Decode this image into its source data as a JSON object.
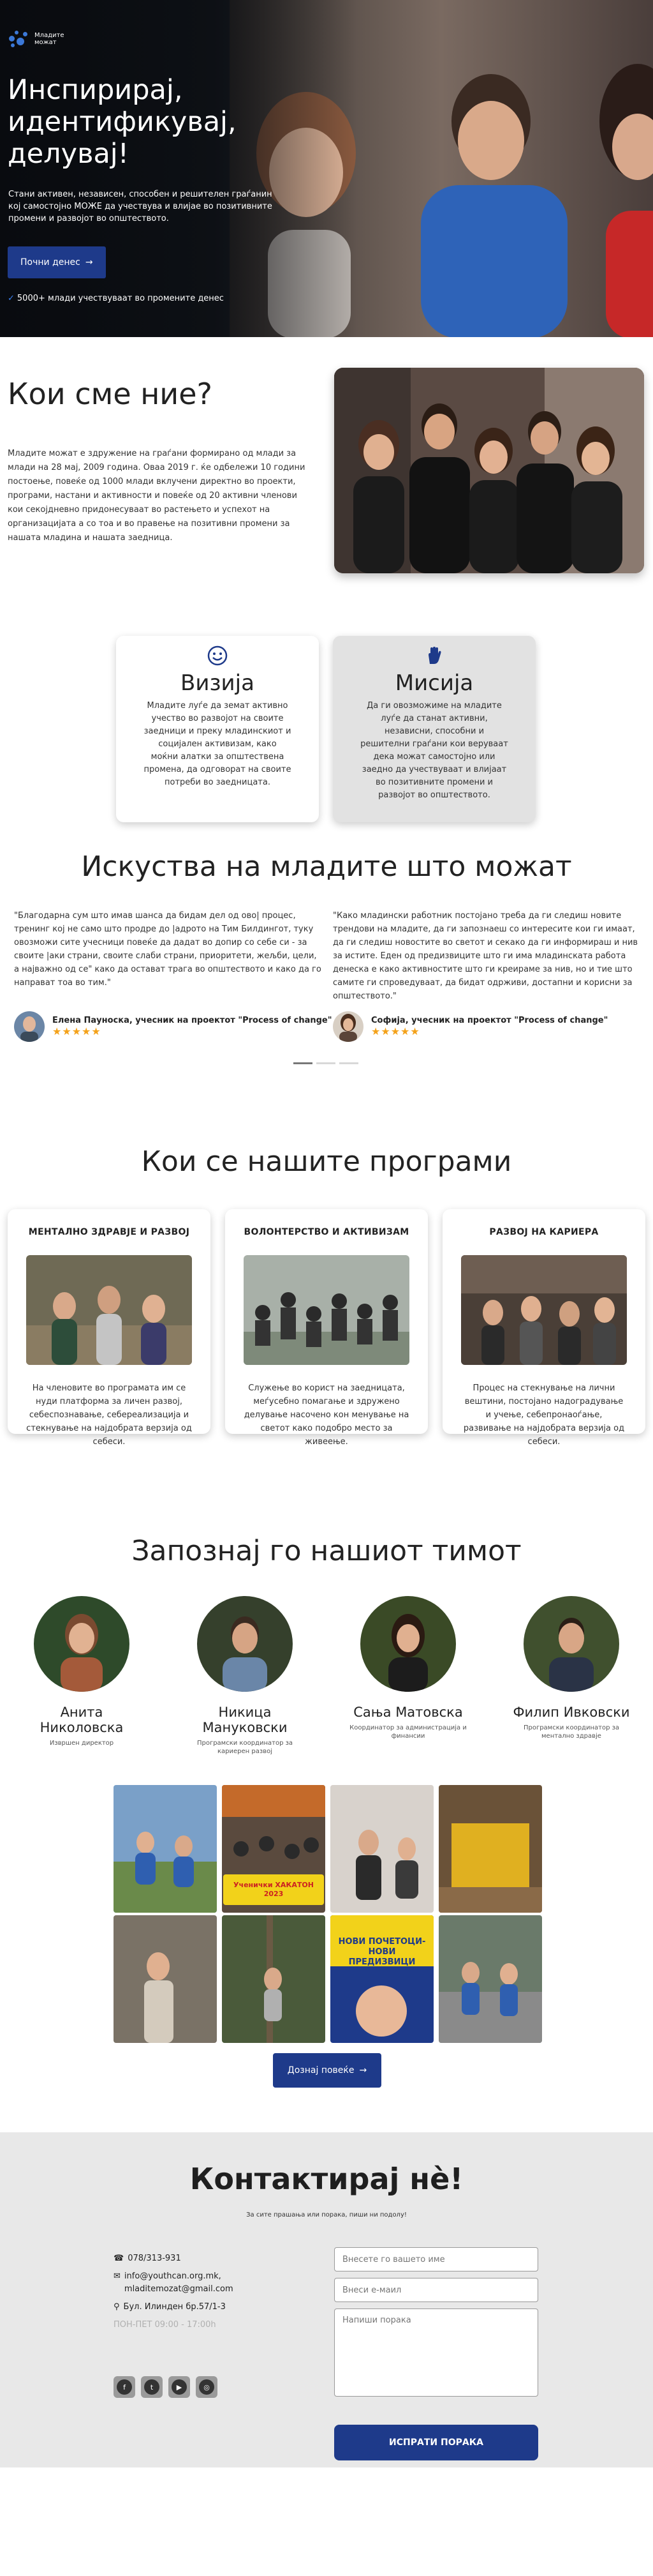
{
  "hero": {
    "logo_text": "Младите можат",
    "title": "Инспирирај, идентификувај, делувај!",
    "subtitle": "Стани активен, независен, способен и решителен граѓанин кој самостојно МОЖЕ да учествува и влијае во позитивните промени и развојот во општеството.",
    "cta_label": "Почни денес",
    "cta_arrow": "→",
    "proof_check": "✓",
    "proof_text": "5000+ млади учествуваат во промените денес"
  },
  "about": {
    "title": "Кои сме ние?",
    "body": "Младите можат е здружение на граѓани формирано од млади за млади на 28 мај, 2009 година. Оваа 2019 г. ќе одбележи 10 години постоење, повеќе од 1000 млади вклучени директно во проекти, програми, настани и активности и повеќе од 20 активни членови кои секојдневно придонесуваат во растењето и успехот на организацијата а со тоа и во правење на позитивни промени за нашата младина и нашата заедница."
  },
  "vision": {
    "icon": "smile-icon",
    "title": "Визија",
    "text": "Младите луѓе да земат активно учество во развојот на своите заедници и преку младинскиот и социјален активизам, како моќни алатки за општествена промена, да одговорат на своите потреби во заедницата."
  },
  "mission": {
    "icon": "hand-icon",
    "title": "Мисија",
    "text": "Да ги овозможиме на младите луѓе да станат активни, независни, способни и решителни граѓани кои веруваат дека можат самостојно или заедно да учествуваат и влијаат во позитивните промени и развојот во општеството."
  },
  "testimonials": {
    "title": "Искуства на младите што можат",
    "items": [
      {
        "quote": "\"Благодарна сум што имав шанса да бидам дел од ово| процес, тренинг кој не само што продре до |адрото на Тим Билдингот, туку овозможи сите учесници повеќе да дадат во допир со себе си - за своите |аки страни, своите слаби страни, приоритети, жељби, цели, а најважно од се\" како да остават трага во општеството и како да го направат тоа во тим.\"",
        "name": "Елена Пауноска, учесник на проектот \"Process of change\"",
        "stars": "★★★★★"
      },
      {
        "quote": "\"Како младински работник постојано треба да ги следиш новите трендови на младите, да ги запознаеш со интересите кои ги имаат, да ги следиш новостите во светот и секако да ги информираш и нив за истите. Еден од предизвиците што ги има младинската работа денеска е како активностите што ги креираме за нив, но и тие што самите ги спроведуваат, да бидат одрживи, достапни и корисни за општеството.\"",
        "name": "Софија, учесник на проектот \"Process of change\"",
        "stars": "★★★★★"
      }
    ]
  },
  "programs": {
    "title": "Кои се нашите програми",
    "items": [
      {
        "heading": "МЕНТАЛНО ЗДРАВЈЕ И РАЗВОЈ",
        "text": "На членовите во програмата им се нуди платформа за личен развој, себеспознавање, себереализација и стекнување на најдобрата верзија од себеси."
      },
      {
        "heading": "ВОЛОНТЕРСТВО И АКТИВИЗАМ",
        "text": "Служење во корист на заедницата, меѓусебно помагање и здружено делување насочено кон менување на светот како подобро место за живеење."
      },
      {
        "heading": "РАЗВОЈ НА КАРИЕРА",
        "text": "Процес на стекнување на лични вештини, постојано надоградување и учење, себепронаоѓање, развивање на најдобрата верзија од себеси."
      }
    ]
  },
  "team": {
    "title": "Запознај го нашиот тимот",
    "members": [
      {
        "name": "Анита Николовска",
        "role": "Извршен директор"
      },
      {
        "name": "Никица Мануковски",
        "role": "Програмски координатор за кариерен развој"
      },
      {
        "name": "Сања Матовска",
        "role": "Координатор за администрација и финансии"
      },
      {
        "name": "Филип Ивковски",
        "role": "Програмски координатор за ментално здравје"
      }
    ]
  },
  "gallery": {
    "poster_hackathon": "Ученички ХАКАТОН 2023",
    "poster_new": "НОВИ ПОЧЕТОЦИ-НОВИ ПРЕДИЗВИЦИ",
    "more_label": "Дознај повеќе",
    "more_arrow": "→"
  },
  "contact": {
    "title": "Контактирај нè!",
    "subtitle": "За сите прашања или поракa, пиши ни подолу!",
    "phone": "078/313-931",
    "email": "info@youthcan.org.mk, mladitemozat@gmail.com",
    "address": "Бул. Илинден бр.57/1-3",
    "hours": "ПОН-ПЕТ 09:00 - 17:00h",
    "name_placeholder": "Внесете го вашето име",
    "email_placeholder": "Внеси е-маил",
    "message_placeholder": "Напиши порака",
    "send_label": "ИСПРАТИ ПОРАКА"
  },
  "colors": {
    "primary": "#1e3a8a",
    "accent_star": "#f4a21a"
  }
}
